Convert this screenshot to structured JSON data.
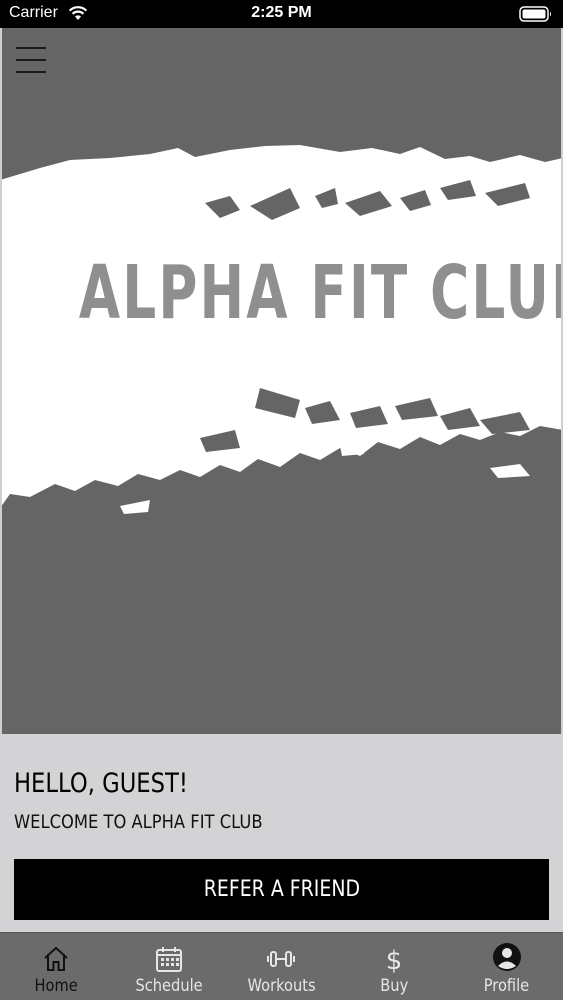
{
  "status_bar": {
    "carrier": "Carrier",
    "time": "2:25 PM"
  },
  "hero": {
    "logo_text": "ALPHA FIT CLUB"
  },
  "greeting": {
    "hello": "HELLO, GUEST!",
    "welcome": "WELCOME TO ALPHA FIT CLUB",
    "refer_button": "REFER A FRIEND"
  },
  "tabs": [
    {
      "label": "Home",
      "icon": "home-icon",
      "active": true
    },
    {
      "label": "Schedule",
      "icon": "calendar-icon",
      "active": false
    },
    {
      "label": "Workouts",
      "icon": "dumbbell-icon",
      "active": false
    },
    {
      "label": "Buy",
      "icon": "dollar-icon",
      "active": false
    },
    {
      "label": "Profile",
      "icon": "profile-icon",
      "active": false
    }
  ],
  "colors": {
    "hero_background": "#656565",
    "greeting_background": "#d3d3d6",
    "button_background": "#000000",
    "tab_bar_background": "#6b6b6b"
  }
}
